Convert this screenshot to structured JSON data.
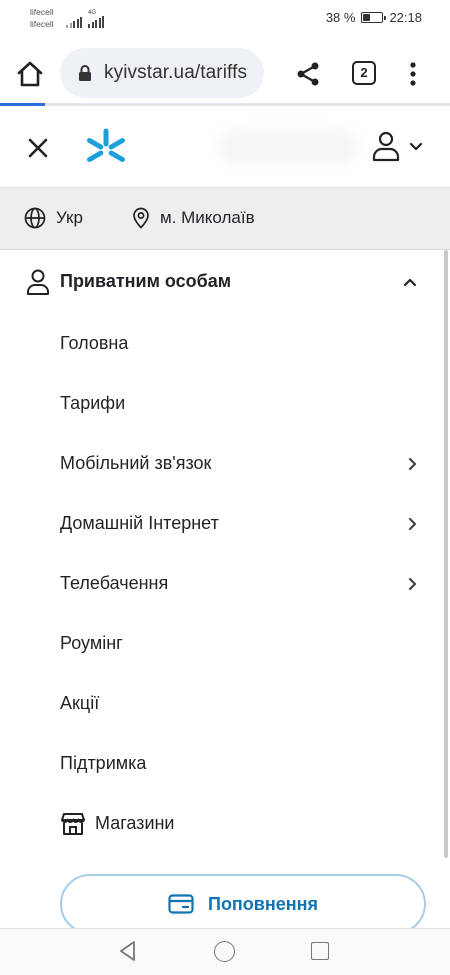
{
  "status_bar": {
    "carrier_1": "lifecell",
    "carrier_2": "lifecell",
    "network_type": "4G",
    "battery_percent_text": "38 %",
    "battery_level": 0.38,
    "time": "22:18"
  },
  "browser": {
    "url": "kyivstar.ua/tariffs",
    "tab_count": "2",
    "home_icon": "home-icon",
    "lock_icon": "lock-icon",
    "share_icon": "share-icon",
    "menu_icon": "more-vert-icon",
    "load_progress": 0.1
  },
  "header": {
    "close_icon": "close-icon",
    "logo_icon": "kyivstar-logo",
    "account_icon": "user-icon",
    "brand_color": "#1ba0dc"
  },
  "locale": {
    "language": "Укр",
    "city": "м. Миколаїв",
    "language_icon": "globe-icon",
    "city_icon": "location-pin-icon"
  },
  "menu": {
    "section_title": "Приватним особам",
    "items": [
      {
        "label": "Головна",
        "has_submenu": false
      },
      {
        "label": "Тарифи",
        "has_submenu": false
      },
      {
        "label": "Мобільний зв'язок",
        "has_submenu": true
      },
      {
        "label": "Домашній Інтернет",
        "has_submenu": true
      },
      {
        "label": "Телебачення",
        "has_submenu": true
      },
      {
        "label": "Роумінг",
        "has_submenu": false
      },
      {
        "label": "Акції",
        "has_submenu": false
      },
      {
        "label": "Підтримка",
        "has_submenu": false
      },
      {
        "label": "Магазини",
        "has_submenu": false,
        "icon": "store-icon"
      }
    ]
  },
  "topup": {
    "label": "Поповнення",
    "icon": "card-icon",
    "accent_color": "#0f74b3"
  },
  "nav_bar": {
    "back_icon": "back-triangle-icon",
    "home_icon": "home-circle-icon",
    "recent_icon": "recent-square-icon"
  }
}
